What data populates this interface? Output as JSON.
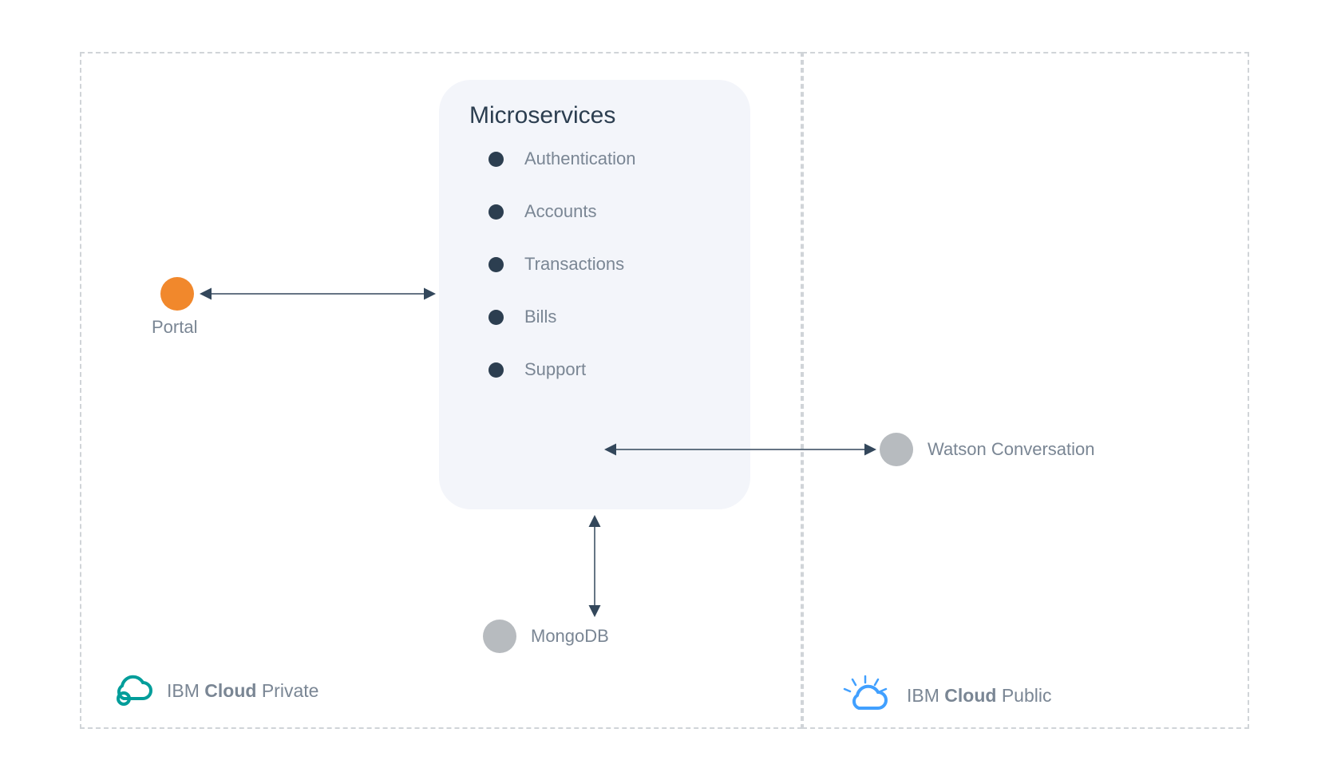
{
  "microservices": {
    "title": "Microservices",
    "items": [
      {
        "label": "Authentication"
      },
      {
        "label": "Accounts"
      },
      {
        "label": "Transactions"
      },
      {
        "label": "Bills"
      },
      {
        "label": "Support"
      }
    ]
  },
  "nodes": {
    "portal": {
      "label": "Portal",
      "color": "#f1882c"
    },
    "mongodb": {
      "label": "MongoDB",
      "color": "#b7bbbf"
    },
    "watson": {
      "label": "Watson Conversation",
      "color": "#b7bbbf"
    }
  },
  "zones": {
    "private": {
      "brand_prefix": "IBM",
      "brand_bold": "Cloud",
      "brand_suffix": "Private"
    },
    "public": {
      "brand_prefix": "IBM",
      "brand_bold": "Cloud",
      "brand_suffix": "Public"
    }
  },
  "connections": [
    {
      "from": "portal",
      "to": "microservices",
      "bidirectional": true
    },
    {
      "from": "support",
      "to": "watson",
      "bidirectional": true
    },
    {
      "from": "microservices",
      "to": "mongodb",
      "bidirectional": true
    }
  ]
}
